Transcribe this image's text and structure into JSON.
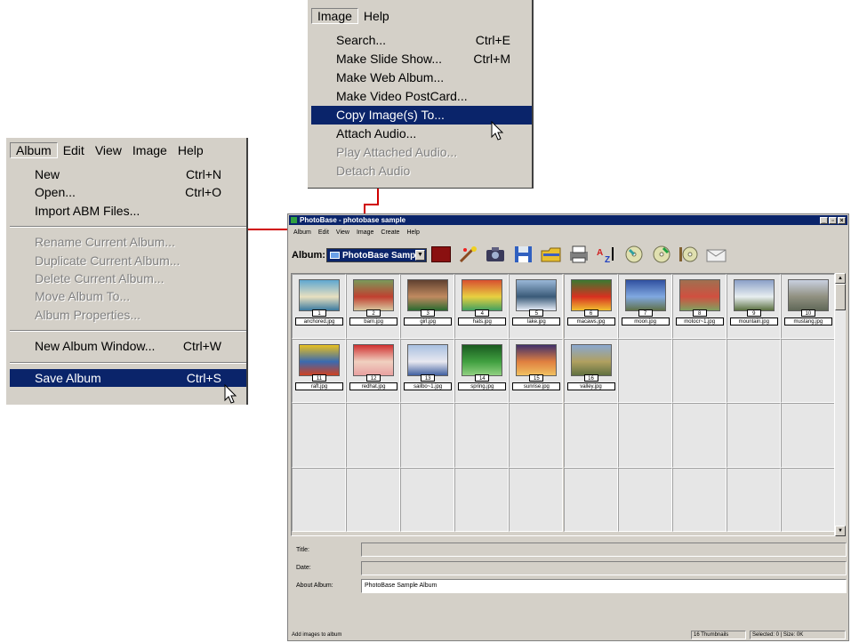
{
  "top_menu": {
    "bar": [
      "Image",
      "Help"
    ],
    "items": [
      {
        "label": "Search...",
        "shortcut": "Ctrl+E",
        "state": "normal"
      },
      {
        "label": "Make Slide Show...",
        "shortcut": "Ctrl+M",
        "state": "normal"
      },
      {
        "label": "Make Web Album...",
        "shortcut": "",
        "state": "normal"
      },
      {
        "label": "Make Video PostCard...",
        "shortcut": "",
        "state": "normal"
      },
      {
        "label": "Copy Image(s) To...",
        "shortcut": "",
        "state": "selected"
      },
      {
        "label": "Attach Audio...",
        "shortcut": "",
        "state": "normal"
      },
      {
        "label": "Play Attached Audio...",
        "shortcut": "",
        "state": "disabled"
      },
      {
        "label": "Detach Audio",
        "shortcut": "",
        "state": "disabled"
      }
    ]
  },
  "left_menu": {
    "bar": [
      "Album",
      "Edit",
      "View",
      "Image",
      "Help"
    ],
    "items": [
      {
        "label": "New",
        "shortcut": "Ctrl+N",
        "state": "normal"
      },
      {
        "label": "Open...",
        "shortcut": "Ctrl+O",
        "state": "normal"
      },
      {
        "label": "Import ABM Files...",
        "shortcut": "",
        "state": "normal"
      },
      {
        "sep": true
      },
      {
        "label": "Rename Current Album...",
        "shortcut": "",
        "state": "disabled"
      },
      {
        "label": "Duplicate Current Album...",
        "shortcut": "",
        "state": "disabled"
      },
      {
        "label": "Delete Current Album...",
        "shortcut": "",
        "state": "disabled"
      },
      {
        "label": "Move Album To...",
        "shortcut": "",
        "state": "disabled"
      },
      {
        "label": "Album Properties...",
        "shortcut": "",
        "state": "disabled"
      },
      {
        "sep": true
      },
      {
        "label": "New Album Window...",
        "shortcut": "Ctrl+W",
        "state": "normal"
      },
      {
        "sep": true
      },
      {
        "label": "Save Album",
        "shortcut": "Ctrl+S",
        "state": "selected"
      }
    ]
  },
  "window": {
    "title": "PhotoBase - photobase sample",
    "menu": [
      "Album",
      "Edit",
      "View",
      "Image",
      "Create",
      "Help"
    ],
    "album_label": "Album:",
    "album_value": "PhotoBase Sample",
    "toolbar_icons": [
      "color-swatch-icon",
      "wizard-icon",
      "camera-icon",
      "save-disk-icon",
      "folder-icon",
      "printer-icon",
      "sort-az-icon",
      "cd-icon",
      "cd-add-icon",
      "audio-cd-icon",
      "envelope-icon"
    ],
    "thumbnails": [
      {
        "num": "1",
        "file": "anchored.jpg",
        "colors": [
          "#5fa8d0",
          "#e8e0c0",
          "#3a7aa0"
        ]
      },
      {
        "num": "2",
        "file": "barn.jpg",
        "colors": [
          "#7a9a5a",
          "#c04030",
          "#d8c8a0"
        ]
      },
      {
        "num": "3",
        "file": "girl.jpg",
        "colors": [
          "#604030",
          "#c08a60",
          "#2a6a30"
        ]
      },
      {
        "num": "4",
        "file": "hats.jpg",
        "colors": [
          "#d85030",
          "#e8d040",
          "#40a060"
        ]
      },
      {
        "num": "5",
        "file": "lake.jpg",
        "colors": [
          "#9ab8d8",
          "#3a5a78",
          "#e8eef8"
        ]
      },
      {
        "num": "6",
        "file": "macaws.jpg",
        "colors": [
          "#3a7a30",
          "#d83020",
          "#f0c030"
        ]
      },
      {
        "num": "7",
        "file": "moon.jpg",
        "colors": [
          "#3050a0",
          "#80a8e0",
          "#607048"
        ]
      },
      {
        "num": "8",
        "file": "motocr~1.jpg",
        "colors": [
          "#a07050",
          "#d05040",
          "#80a060"
        ]
      },
      {
        "num": "9",
        "file": "mountain.jpg",
        "colors": [
          "#8aa0c8",
          "#e8eef0",
          "#5a7040"
        ]
      },
      {
        "num": "10",
        "file": "mustang.jpg",
        "colors": [
          "#c8d0e0",
          "#909080",
          "#606858"
        ]
      },
      {
        "num": "11",
        "file": "raft.jpg",
        "colors": [
          "#e8c020",
          "#3a6ab0",
          "#d04020"
        ]
      },
      {
        "num": "12",
        "file": "redhat.jpg",
        "colors": [
          "#d03030",
          "#f0d0c0",
          "#e8a0a0"
        ]
      },
      {
        "num": "13",
        "file": "sailbo~1.jpg",
        "colors": [
          "#a8c0e0",
          "#e8e8f0",
          "#4060a0"
        ]
      },
      {
        "num": "14",
        "file": "spring.jpg",
        "colors": [
          "#1a5a20",
          "#40a040",
          "#90d080"
        ]
      },
      {
        "num": "15",
        "file": "sunrise.jpg",
        "colors": [
          "#40306a",
          "#e08040",
          "#f0c060"
        ]
      },
      {
        "num": "16",
        "file": "valley.jpg",
        "colors": [
          "#8aa8d0",
          "#b0a060",
          "#607040"
        ]
      }
    ],
    "fields": {
      "title_label": "Title:",
      "date_label": "Date:",
      "about_label": "About Album:",
      "about_value": "PhotoBase Sample Album"
    },
    "status": {
      "left": "Add images to album",
      "count": "16 Thumbnails",
      "selection": "Selected: 0  |  Size: 0K"
    }
  },
  "colors": {
    "highlight": "#0a246a",
    "callout": "#d00000",
    "face": "#d4d0c8"
  }
}
